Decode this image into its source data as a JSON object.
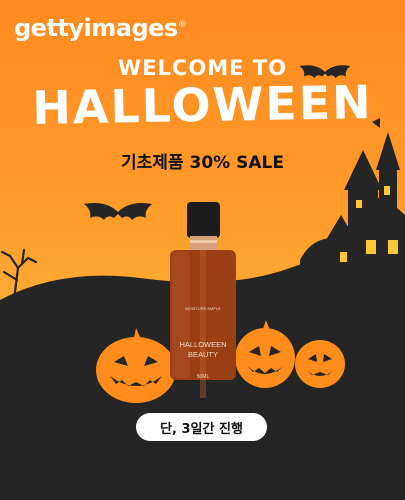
{
  "brand": {
    "logo_text": "gettyimages",
    "trademark": "®"
  },
  "headline": {
    "welcome": "WELCOME TO",
    "title": "HALLOWEEN"
  },
  "promo": {
    "sale_text": "기초제품 30% SALE"
  },
  "product": {
    "small_label": "MOISTURE AMPLE",
    "name_line1": "HALLOWEEN",
    "name_line2": "BEAUTY",
    "volume": "50ML"
  },
  "cta": {
    "label": "단, 3일간 진행"
  },
  "colors": {
    "background_top": "#ff8a1f",
    "background_bottom": "#ffbb3e",
    "silhouette": "#252525",
    "pumpkin": "#ff8d1c",
    "bottle": "#9a3f14",
    "cap": "#d8a07a"
  },
  "icons": [
    "bat-icon",
    "castle-icon",
    "pumpkin-icon",
    "tombstone-icon",
    "dead-tree-icon",
    "dropper-bottle-icon"
  ]
}
